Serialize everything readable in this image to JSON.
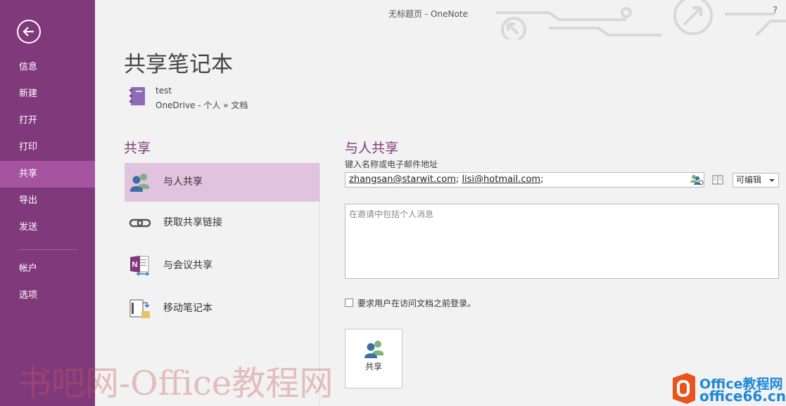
{
  "window": {
    "title": "无标题页 - OneNote",
    "help": "?"
  },
  "sidebar": {
    "items": [
      {
        "label": "信息"
      },
      {
        "label": "新建"
      },
      {
        "label": "打开"
      },
      {
        "label": "打印"
      },
      {
        "label": "共享",
        "active": true
      },
      {
        "label": "导出"
      },
      {
        "label": "发送"
      },
      {
        "label": "帐户"
      },
      {
        "label": "选项"
      }
    ]
  },
  "page": {
    "title": "共享笔记本",
    "notebook": {
      "name": "test",
      "location": "OneDrive - 个人 » 文档"
    }
  },
  "share_panel": {
    "heading": "共享",
    "options": [
      {
        "label": "与人共享",
        "icon": "people-icon",
        "selected": true
      },
      {
        "label": "获取共享链接",
        "icon": "link-icon"
      },
      {
        "label": "与会议共享",
        "icon": "onenote-meeting-icon"
      },
      {
        "label": "移动笔记本",
        "icon": "move-notebook-icon"
      }
    ]
  },
  "share_with_people": {
    "heading": "与人共享",
    "input_label": "键入名称或电子邮件地址",
    "recipients": [
      "zhangsan@starwit.com",
      "lisi@hotmail.com"
    ],
    "permission": "可编辑",
    "message_placeholder": "在邀请中包括个人消息",
    "require_signin_label": "要求用户在访问文档之前登录。",
    "share_button_label": "共享"
  },
  "watermark": {
    "text": "书吧网-Office教程网",
    "logo_line1": "Office教程网",
    "logo_line2": "office66.cn"
  },
  "colors": {
    "accent": "#80397b",
    "active_nav": "#a653a0",
    "selected_option": "#e1c2df"
  }
}
